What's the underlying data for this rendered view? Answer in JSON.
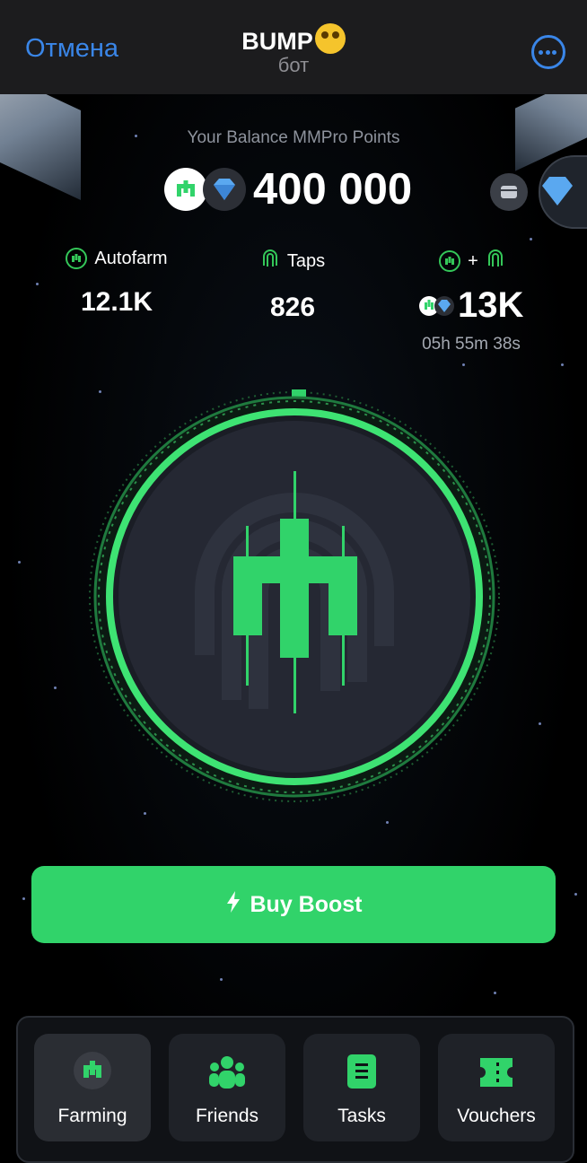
{
  "header": {
    "cancel_label": "Отмена",
    "title": "BUMP",
    "subtitle": "бот"
  },
  "balance": {
    "label": "Your Balance MMPro Points",
    "value": "400 000"
  },
  "stats": {
    "autofarm": {
      "label": "Autofarm",
      "value": "12.1K"
    },
    "taps": {
      "label": "Taps",
      "value": "826"
    },
    "combined": {
      "plus": "+",
      "value": "13K",
      "timer": "05h 55m 38s"
    }
  },
  "boost_button": {
    "label": "Buy Boost"
  },
  "tabs": [
    {
      "label": "Farming",
      "icon": "mm-logo-icon"
    },
    {
      "label": "Friends",
      "icon": "friends-icon"
    },
    {
      "label": "Tasks",
      "icon": "tasks-icon"
    },
    {
      "label": "Vouchers",
      "icon": "voucher-icon"
    }
  ],
  "colors": {
    "accent_green": "#31d36a",
    "telegram_blue": "#3a86e8",
    "coin_dark": "#2c2f36"
  }
}
